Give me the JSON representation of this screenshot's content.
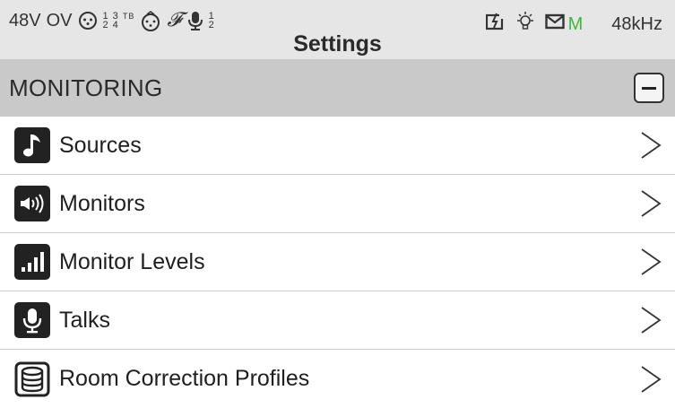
{
  "status_bar": {
    "phantom": "48V",
    "overload": "OV",
    "xlr_inputs": {
      "top": "1 3",
      "bottom": "2 4",
      "suffix": "TB"
    },
    "talk_channels": {
      "top": "1",
      "bottom": "2"
    },
    "sample_rate": "48kHz",
    "mode_indicator": "M",
    "mode_color": "#3cb83c"
  },
  "header": {
    "title": "Settings"
  },
  "section": {
    "title": "MONITORING",
    "collapse_icon": "minus-icon"
  },
  "menu_items": [
    {
      "label": "Sources",
      "icon": "music-note-icon"
    },
    {
      "label": "Monitors",
      "icon": "speaker-icon"
    },
    {
      "label": "Monitor Levels",
      "icon": "level-bars-icon"
    },
    {
      "label": "Talks",
      "icon": "microphone-icon"
    },
    {
      "label": "Room Correction Profiles",
      "icon": "database-icon"
    }
  ]
}
